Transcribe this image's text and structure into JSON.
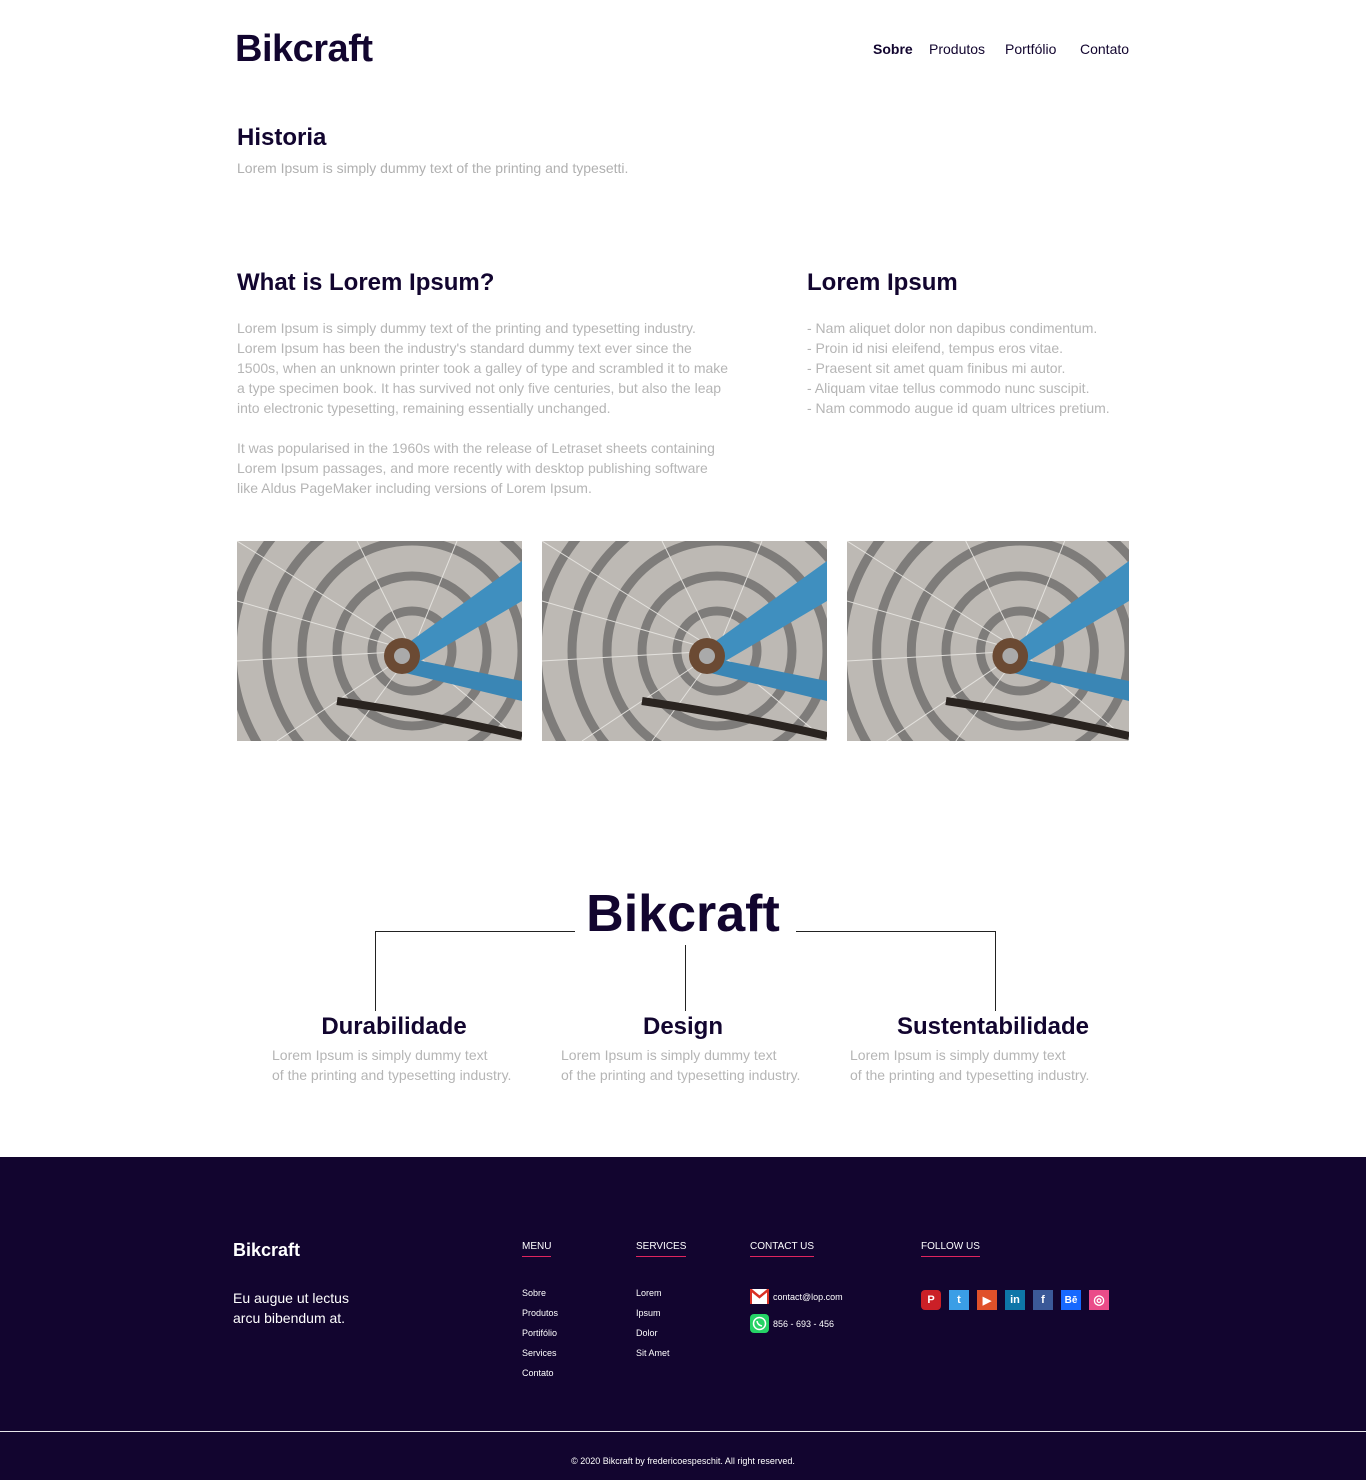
{
  "header": {
    "logo": "Bikcraft",
    "nav": [
      "Sobre",
      "Produtos",
      "Portfólio",
      "Contato"
    ]
  },
  "historia": {
    "title": "Historia",
    "subtitle": "Lorem Ipsum is simply dummy text of the printing and typesetti."
  },
  "about": {
    "title": "What is Lorem Ipsum?",
    "paragraph1": [
      "Lorem Ipsum is simply dummy text of the printing and typesetting industry.",
      "Lorem Ipsum has been the industry's standard dummy text ever since the",
      "1500s, when an unknown printer took a galley of type and scrambled it to make",
      "a type specimen book. It has survived not only five centuries, but also the leap",
      "into electronic typesetting, remaining essentially unchanged."
    ],
    "paragraph2": [
      "It was popularised in the 1960s with the release of Letraset sheets containing",
      "Lorem Ipsum passages, and more recently with desktop publishing software",
      "like Aldus PageMaker including versions of Lorem Ipsum."
    ]
  },
  "list_section": {
    "title": "Lorem Ipsum",
    "items": [
      "- Nam aliquet dolor non dapibus condimentum.",
      "- Proin id nisi eleifend, tempus eros vitae.",
      "- Praesent sit amet quam finibus mi autor.",
      "- Aliquam vitae tellus commodo nunc suscipit.",
      "- Nam commodo augue id quam ultrices pretium."
    ]
  },
  "values": {
    "logo": "Bikcraft",
    "items": [
      {
        "title": "Durabilidade",
        "line1": "Lorem Ipsum is simply dummy text",
        "line2": "of the printing and typesetting industry."
      },
      {
        "title": "Design",
        "line1": "Lorem Ipsum is simply dummy text",
        "line2": "of the printing and typesetting industry."
      },
      {
        "title": "Sustentabilidade",
        "line1": "Lorem Ipsum is simply dummy text",
        "line2": "of the printing and typesetting industry."
      }
    ]
  },
  "footer": {
    "logo": "Bikcraft",
    "tagline_lines": [
      "Eu augue ut lectus",
      "arcu bibendum at."
    ],
    "menu_heading": "MENU",
    "menu_items": [
      "Sobre",
      "Produtos",
      "Portifólio",
      "Services",
      "Contato"
    ],
    "services_heading": "SERVICES",
    "services_items": [
      "Lorem",
      "Ipsum",
      "Dolor",
      "Sit Amet"
    ],
    "contact_heading": "CONTACT US",
    "email": "contact@lop.com",
    "phone": "856 - 693 - 456",
    "follow_heading": "FOLLOW US",
    "social": [
      {
        "icon": "pinterest-icon",
        "glyph": "P",
        "color": "#cb2027"
      },
      {
        "icon": "twitter-icon",
        "glyph": "t",
        "color": "#3a9ee6"
      },
      {
        "icon": "youtube-icon",
        "glyph": "▶",
        "color": "#e0512a"
      },
      {
        "icon": "linkedin-icon",
        "glyph": "in",
        "color": "#0e76a8"
      },
      {
        "icon": "facebook-icon",
        "glyph": "f",
        "color": "#3b5998"
      },
      {
        "icon": "behance-icon",
        "glyph": "Bē",
        "color": "#1769ff"
      },
      {
        "icon": "dribbble-icon",
        "glyph": "◎",
        "color": "#ea4c89"
      }
    ],
    "copyright": "© 2020 Bikcraft by fredericoespeschit. All right reserved."
  },
  "colors": {
    "brand": "#12052f",
    "muted_text": "#b5b5b5",
    "accent": "#e0245e"
  }
}
